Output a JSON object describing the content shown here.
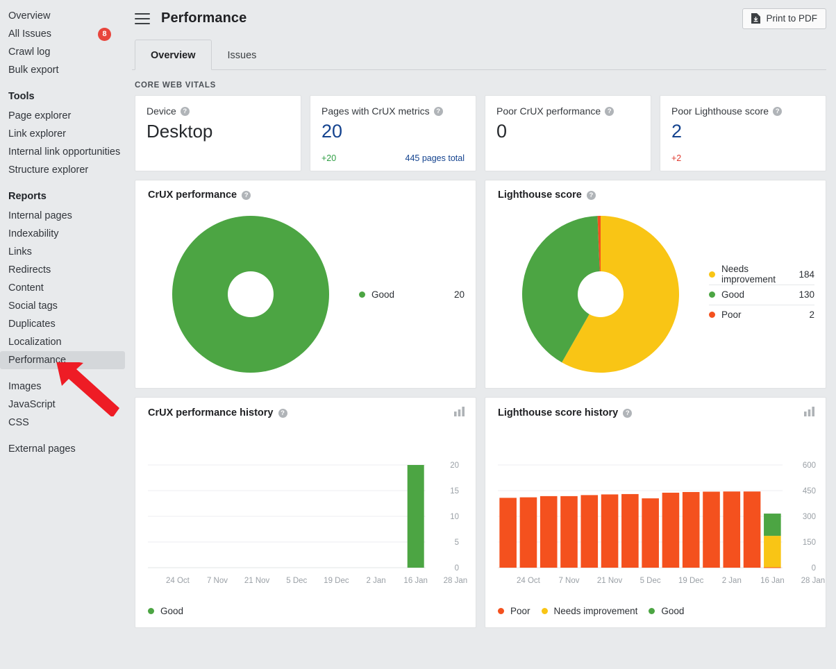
{
  "sidebar": {
    "items": [
      {
        "label": "Overview",
        "type": "link",
        "active": false
      },
      {
        "label": "All Issues",
        "type": "link",
        "active": false,
        "badge": "8"
      },
      {
        "label": "Crawl log",
        "type": "link",
        "active": false
      },
      {
        "label": "Bulk export",
        "type": "link",
        "active": false
      },
      {
        "label": "Tools",
        "type": "group"
      },
      {
        "label": "Page explorer",
        "type": "link",
        "active": false
      },
      {
        "label": "Link explorer",
        "type": "link",
        "active": false
      },
      {
        "label": "Internal link opportunities",
        "type": "link",
        "active": false
      },
      {
        "label": "Structure explorer",
        "type": "link",
        "active": false
      },
      {
        "label": "Reports",
        "type": "group"
      },
      {
        "label": "Internal pages",
        "type": "link",
        "active": false
      },
      {
        "label": "Indexability",
        "type": "link",
        "active": false
      },
      {
        "label": "Links",
        "type": "link",
        "active": false
      },
      {
        "label": "Redirects",
        "type": "link",
        "active": false
      },
      {
        "label": "Content",
        "type": "link",
        "active": false
      },
      {
        "label": "Social tags",
        "type": "link",
        "active": false
      },
      {
        "label": "Duplicates",
        "type": "link",
        "active": false
      },
      {
        "label": "Localization",
        "type": "link",
        "active": false
      },
      {
        "label": "Performance",
        "type": "link",
        "active": true
      },
      {
        "label": "",
        "type": "spacer"
      },
      {
        "label": "Images",
        "type": "link",
        "active": false
      },
      {
        "label": "JavaScript",
        "type": "link",
        "active": false
      },
      {
        "label": "CSS",
        "type": "link",
        "active": false
      },
      {
        "label": "",
        "type": "spacer"
      },
      {
        "label": "External pages",
        "type": "link",
        "active": false
      }
    ]
  },
  "header": {
    "title": "Performance",
    "menu_icon": "hamburger-icon",
    "print_button": {
      "label": "Print to PDF",
      "icon": "file-download-icon"
    }
  },
  "tabs": [
    {
      "label": "Overview",
      "active": true
    },
    {
      "label": "Issues",
      "active": false
    }
  ],
  "section": {
    "label": "CORE WEB VITALS"
  },
  "kpis": [
    {
      "title": "Device",
      "value": "Desktop",
      "value_style": "big",
      "delta": "",
      "link": ""
    },
    {
      "title": "Pages with CrUX metrics",
      "value": "20",
      "value_style": "blue",
      "delta": "+20",
      "delta_style": "green",
      "link": "445 pages total"
    },
    {
      "title": "Poor CrUX performance",
      "value": "0",
      "value_style": "dark",
      "delta": "",
      "link": ""
    },
    {
      "title": "Poor Lighthouse score",
      "value": "2",
      "value_style": "blue",
      "delta": "+2",
      "delta_style": "red",
      "link": ""
    }
  ],
  "colors": {
    "good": "#4CA543",
    "needs_improvement": "#F9C515",
    "poor": "#F4511E",
    "accent_blue": "#14438f",
    "badge_red": "#e8453c",
    "page_bg": "#e8eaec"
  },
  "chart_data": [
    {
      "type": "pie",
      "title": "CrUX performance",
      "id": "crux-performance-donut",
      "categories": [
        "Good"
      ],
      "values": [
        20
      ],
      "colors": [
        "#4CA543"
      ],
      "legend_position": "right",
      "donut": true
    },
    {
      "type": "pie",
      "title": "Lighthouse score",
      "id": "lighthouse-score-donut",
      "categories": [
        "Needs improvement",
        "Good",
        "Poor"
      ],
      "values": [
        184,
        130,
        2
      ],
      "colors": [
        "#F9C515",
        "#4CA543",
        "#F4511E"
      ],
      "legend_position": "right",
      "donut": true
    },
    {
      "type": "bar",
      "title": "CrUX performance history",
      "id": "crux-performance-history",
      "stacked": true,
      "xlabel": "",
      "ylabel": "",
      "ylim": [
        0,
        20
      ],
      "yticks": [
        0,
        5,
        10,
        15,
        20
      ],
      "grid": true,
      "x": [
        "24 Oct",
        "7 Nov",
        "21 Nov",
        "5 Dec",
        "19 Dec",
        "2 Jan",
        "16 Jan",
        "28 Jan"
      ],
      "bar_slots": 14,
      "series": [
        {
          "name": "Good",
          "color": "#4CA543",
          "values": [
            0,
            0,
            0,
            0,
            0,
            0,
            0,
            0,
            0,
            0,
            0,
            0,
            0,
            20
          ]
        }
      ],
      "legend": [
        "Good"
      ]
    },
    {
      "type": "bar",
      "title": "Lighthouse score history",
      "id": "lighthouse-score-history",
      "stacked": true,
      "xlabel": "",
      "ylabel": "",
      "ylim": [
        0,
        600
      ],
      "yticks": [
        0,
        150,
        300,
        450,
        600
      ],
      "grid": true,
      "x": [
        "24 Oct",
        "7 Nov",
        "21 Nov",
        "5 Dec",
        "19 Dec",
        "2 Jan",
        "16 Jan",
        "28 Jan"
      ],
      "bar_slots": 14,
      "series": [
        {
          "name": "Poor",
          "color": "#F4511E",
          "values": [
            408,
            411,
            418,
            418,
            424,
            428,
            430,
            405,
            438,
            442,
            444,
            445,
            445,
            2
          ]
        },
        {
          "name": "Needs improvement",
          "color": "#F9C515",
          "values": [
            0,
            0,
            0,
            0,
            0,
            0,
            0,
            0,
            0,
            0,
            0,
            0,
            0,
            184
          ]
        },
        {
          "name": "Good",
          "color": "#4CA543",
          "values": [
            0,
            0,
            0,
            0,
            0,
            0,
            0,
            0,
            0,
            0,
            0,
            0,
            0,
            130
          ]
        }
      ],
      "legend": [
        "Poor",
        "Needs improvement",
        "Good"
      ]
    }
  ],
  "cards": {
    "crux_performance": {
      "title": "CrUX performance",
      "help": "help-icon"
    },
    "lighthouse_score": {
      "title": "Lighthouse score",
      "help": "help-icon"
    },
    "crux_history": {
      "title": "CrUX performance history",
      "help": "help-icon",
      "toggle": "bar-chart-icon"
    },
    "lighthouse_history": {
      "title": "Lighthouse score history",
      "help": "help-icon",
      "toggle": "bar-chart-icon"
    }
  }
}
